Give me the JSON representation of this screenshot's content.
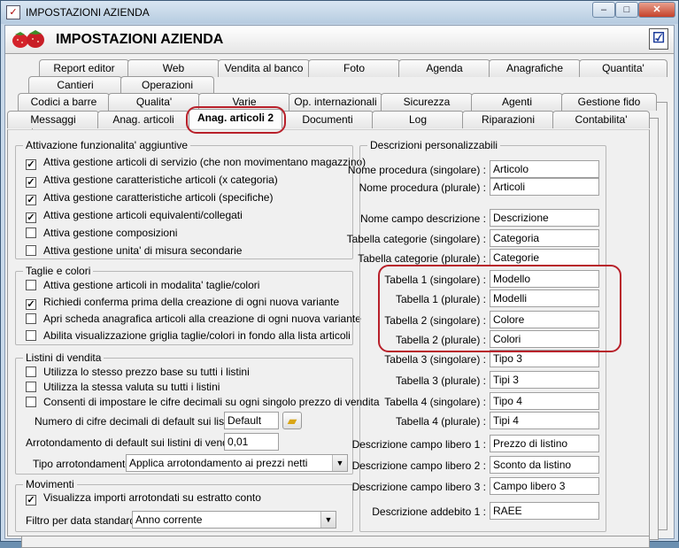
{
  "window": {
    "title": "IMPOSTAZIONI AZIENDA",
    "minimize": "–",
    "maximize": "□",
    "close": "✕"
  },
  "header": {
    "title": "IMPOSTAZIONI AZIENDA"
  },
  "tabs": {
    "row1": [
      "Report editor",
      "Web",
      "Vendita al banco",
      "Foto",
      "Agenda",
      "Anagrafiche",
      "Quantita'"
    ],
    "row2": [
      "Cantieri",
      "Operazioni"
    ],
    "row3": [
      "Codici a barre",
      "Qualita'",
      "Varie",
      "Op. internazionali",
      "Sicurezza",
      "Agenti",
      "Gestione fido"
    ],
    "row4": [
      "Messaggi",
      "Anag. articoli",
      "Anag. articoli 2",
      "Documenti",
      "Log",
      "Riparazioni",
      "Contabilita'"
    ]
  },
  "left": {
    "group1": {
      "title": "Attivazione funzionalita' aggiuntive",
      "items": [
        {
          "label": "Attiva gestione articoli di servizio (che non movimentano magazzino)",
          "checked": true
        },
        {
          "label": "Attiva gestione caratteristiche articoli (x categoria)",
          "checked": true
        },
        {
          "label": "Attiva gestione caratteristiche articoli (specifiche)",
          "checked": true
        },
        {
          "label": "Attiva gestione articoli equivalenti/collegati",
          "checked": true
        },
        {
          "label": "Attiva gestione composizioni",
          "checked": false
        },
        {
          "label": "Attiva gestione unita' di misura secondarie",
          "checked": false
        }
      ]
    },
    "group2": {
      "title": "Taglie e colori",
      "items": [
        {
          "label": "Attiva gestione articoli in modalita' taglie/colori",
          "checked": false
        },
        {
          "label": "Richiedi conferma prima della creazione di ogni nuova variante",
          "checked": true
        },
        {
          "label": "Apri scheda anagrafica articoli alla creazione di ogni nuova variante",
          "checked": false
        },
        {
          "label": "Abilita visualizzazione griglia taglie/colori in fondo alla lista articoli",
          "checked": false
        }
      ]
    },
    "group3": {
      "title": "Listini di vendita",
      "items": [
        {
          "label": "Utilizza lo stesso prezzo base su tutti i listini",
          "checked": false
        },
        {
          "label": "Utilizza la stessa valuta su tutti i listini",
          "checked": false
        },
        {
          "label": "Consenti di impostare le cifre decimali su ogni singolo prezzo di vendita",
          "checked": false
        }
      ],
      "decimals_label": "Numero di cifre decimali di default sui listini :",
      "decimals_value": "Default",
      "rounding_label": "Arrotondamento di default sui listini di vendita :",
      "rounding_value": "0,01",
      "round_type_label": "Tipo arrotondamento :",
      "round_type_value": "Applica arrotondamento ai prezzi netti"
    },
    "group4": {
      "title": "Movimenti",
      "items": [
        {
          "label": "Visualizza importi arrotondati su estratto conto",
          "checked": true
        }
      ],
      "filter_label": "Filtro per data standard :",
      "filter_value": "Anno corrente"
    }
  },
  "right": {
    "title": "Descrizioni personalizzabili",
    "rows": [
      {
        "label": "Nome procedura (singolare) :",
        "value": "Articolo"
      },
      {
        "label": "Nome procedura (plurale) :",
        "value": "Articoli"
      },
      {
        "label": "Nome campo descrizione :",
        "value": "Descrizione"
      },
      {
        "label": "Tabella categorie (singolare) :",
        "value": "Categoria"
      },
      {
        "label": "Tabella categorie (plurale) :",
        "value": "Categorie"
      },
      {
        "label": "Tabella 1 (singolare) :",
        "value": "Modello"
      },
      {
        "label": "Tabella 1 (plurale) :",
        "value": "Modelli"
      },
      {
        "label": "Tabella 2 (singolare) :",
        "value": "Colore"
      },
      {
        "label": "Tabella 2 (plurale) :",
        "value": "Colori"
      },
      {
        "label": "Tabella 3 (singolare) :",
        "value": "Tipo 3"
      },
      {
        "label": "Tabella 3 (plurale) :",
        "value": "Tipi 3"
      },
      {
        "label": "Tabella 4 (singolare) :",
        "value": "Tipo 4"
      },
      {
        "label": "Tabella 4 (plurale) :",
        "value": "Tipi 4"
      },
      {
        "label": "Descrizione campo libero 1 :",
        "value": "Prezzo di listino"
      },
      {
        "label": "Descrizione campo libero 2 :",
        "value": "Sconto da listino"
      },
      {
        "label": "Descrizione campo libero 3 :",
        "value": "Campo libero 3"
      },
      {
        "label": "Descrizione addebito 1 :",
        "value": "RAEE"
      }
    ]
  },
  "icons": {
    "title": "form-icon",
    "logo": "strawberry-icon",
    "check": "checklist-icon",
    "folder": "folder-icon"
  },
  "colors": {
    "highlight": "#b8202a"
  }
}
